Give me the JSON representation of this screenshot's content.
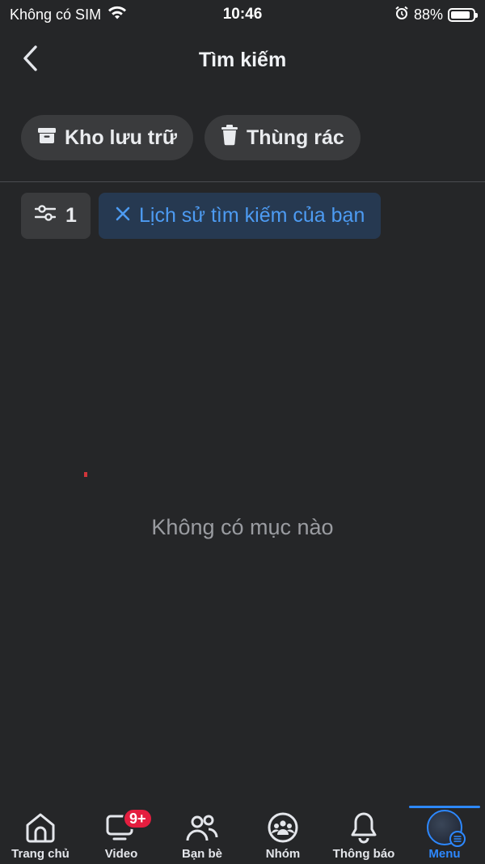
{
  "status_bar": {
    "carrier": "Không có SIM",
    "time": "10:46",
    "battery": "88%",
    "battery_level": 0.88,
    "icons": [
      "wifi-icon",
      "alarm-icon",
      "battery-icon"
    ]
  },
  "header": {
    "title": "Tìm kiếm",
    "back_icon": "chevron-left-icon"
  },
  "chips": {
    "archive": {
      "label": "Kho lưu trữ",
      "icon": "archive-box-icon"
    },
    "trash": {
      "label": "Thùng rác",
      "icon": "trash-icon"
    }
  },
  "filters": {
    "filter_count": "1",
    "filter_icon": "sliders-icon",
    "active_filter": {
      "label": "Lịch sử tìm kiếm của bạn",
      "icon": "close-icon"
    }
  },
  "empty_state": {
    "message": "Không có mục nào"
  },
  "tab_bar": {
    "tabs": [
      {
        "label": "Trang chủ",
        "icon": "home-icon"
      },
      {
        "label": "Video",
        "icon": "video-icon",
        "badge": "9+"
      },
      {
        "label": "Bạn bè",
        "icon": "friends-icon"
      },
      {
        "label": "Nhóm",
        "icon": "groups-icon"
      },
      {
        "label": "Thông báo",
        "icon": "bell-icon"
      },
      {
        "label": "Menu",
        "icon": "avatar-menu-icon",
        "active": true
      }
    ]
  },
  "colors": {
    "background": "#252628",
    "chip": "#3a3b3d",
    "accent": "#2d88ff",
    "active_filter_bg": "#263951",
    "active_filter_text": "#4d9bf2",
    "badge": "#e41e3f",
    "muted_text": "#9a9ca1"
  }
}
